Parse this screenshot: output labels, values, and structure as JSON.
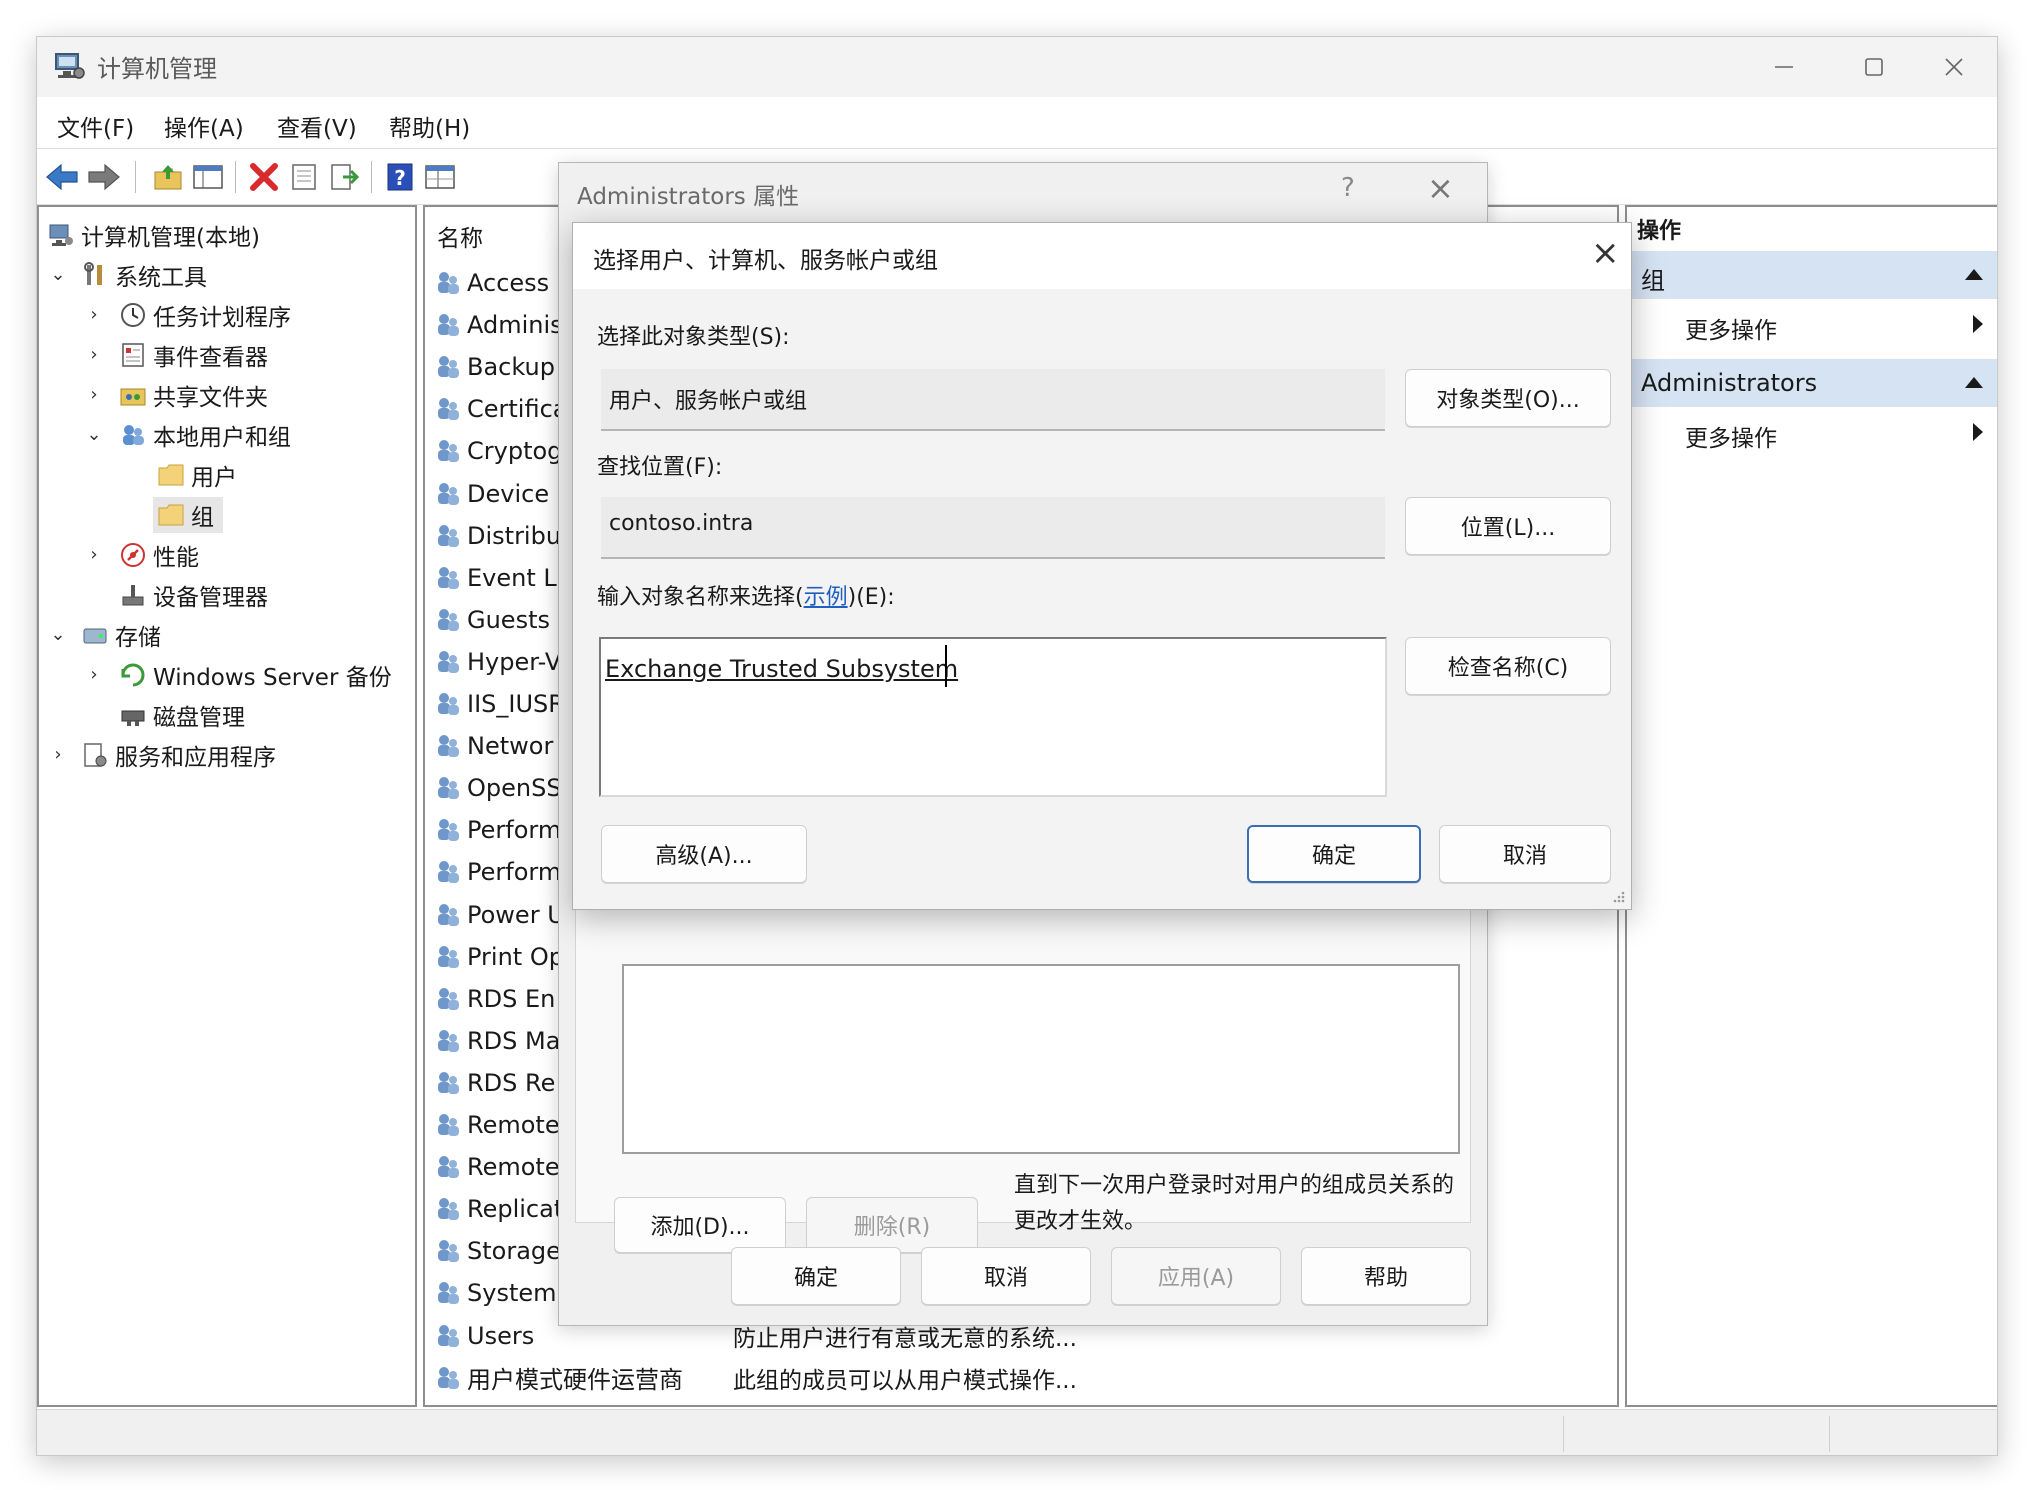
{
  "window": {
    "title": "计算机管理"
  },
  "menu": [
    "文件(F)",
    "操作(A)",
    "查看(V)",
    "帮助(H)"
  ],
  "toolbar": {
    "icons": [
      "back-arrow-icon",
      "forward-arrow-icon",
      "up-folder-icon",
      "show-hide-tree-icon",
      "delete-icon",
      "properties-icon",
      "export-list-icon",
      "help-icon",
      "console-tree-icon"
    ],
    "colors": {
      "back_forward": "#3a78c8",
      "delete": "#d92b2b",
      "help": "#2a4fb8"
    }
  },
  "tree": {
    "root": "计算机管理(本地)",
    "system_tools": "系统工具",
    "task_scheduler": "任务计划程序",
    "event_viewer": "事件查看器",
    "shared_folders": "共享文件夹",
    "local_users_groups": "本地用户和组",
    "users": "用户",
    "groups": "组",
    "performance": "性能",
    "device_manager": "设备管理器",
    "storage": "存储",
    "windows_server_backup": "Windows Server 备份",
    "disk_management": "磁盘管理",
    "services_apps": "服务和应用程序"
  },
  "list": {
    "header": "名称",
    "rows": [
      {
        "name": "Access",
        "desc": ""
      },
      {
        "name": "Adminis",
        "desc": ""
      },
      {
        "name": "Backup",
        "desc": ""
      },
      {
        "name": "Certifica",
        "desc": ""
      },
      {
        "name": "Cryptog",
        "desc": ""
      },
      {
        "name": "Device",
        "desc": ""
      },
      {
        "name": "Distribu",
        "desc": ""
      },
      {
        "name": "Event L",
        "desc": ""
      },
      {
        "name": "Guests",
        "desc": ""
      },
      {
        "name": "Hyper-V",
        "desc": ""
      },
      {
        "name": "IIS_IUSR",
        "desc": ""
      },
      {
        "name": "Networ",
        "desc": ""
      },
      {
        "name": "OpenSS",
        "desc": ""
      },
      {
        "name": "Perform",
        "desc": ""
      },
      {
        "name": "Perform",
        "desc": ""
      },
      {
        "name": "Power U",
        "desc": ""
      },
      {
        "name": "Print Op",
        "desc": ""
      },
      {
        "name": "RDS En",
        "desc": ""
      },
      {
        "name": "RDS Ma",
        "desc": ""
      },
      {
        "name": "RDS Re",
        "desc": ""
      },
      {
        "name": "Remote",
        "desc": ""
      },
      {
        "name": "Remote",
        "desc": ""
      },
      {
        "name": "Replicat",
        "desc": ""
      },
      {
        "name": "Storage",
        "desc": ""
      },
      {
        "name": "System",
        "desc": ""
      },
      {
        "name": "Users",
        "desc": "防止用户进行有意或无意的系统..."
      },
      {
        "name": "用户模式硬件运营商",
        "desc": "此组的成员可以从用户模式操作..."
      }
    ]
  },
  "actions": {
    "header": "操作",
    "section1": "组",
    "section1_item": "更多操作",
    "section2": "Administrators",
    "section2_item": "更多操作",
    "section_color": "#d6e3f3"
  },
  "props_dialog": {
    "title": "Administrators 属性",
    "help_glyph": "?",
    "note": "直到下一次用户登录时对用户的组成员关系的更改才生效。",
    "add": "添加(D)...",
    "remove": "删除(R)",
    "ok": "确定",
    "cancel": "取消",
    "apply": "应用(A)",
    "help": "帮助"
  },
  "select_dialog": {
    "title": "选择用户、计算机、服务帐户或组",
    "object_type_label": "选择此对象类型(S):",
    "object_type_value": "用户、服务帐户或组",
    "object_types_button": "对象类型(O)...",
    "location_label": "查找位置(F):",
    "location_value": "contoso.intra",
    "locations_button": "位置(L)...",
    "names_label_prefix": "输入对象名称来选择(",
    "names_label_link": "示例",
    "names_label_suffix": ")(E):",
    "names_value": "Exchange Trusted Subsystem",
    "check_names_button": "检查名称(C)",
    "advanced_button": "高级(A)...",
    "ok_button": "确定",
    "cancel_button": "取消",
    "link_color": "#1f5fbf",
    "primary_border_color": "#3a6fb5"
  }
}
